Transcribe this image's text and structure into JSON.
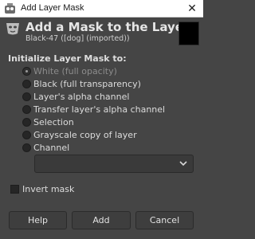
{
  "window": {
    "title": "Add Layer Mask",
    "close_glyph": "✕"
  },
  "header": {
    "title": "Add a Mask to the Layer",
    "subtitle": "Black-47 ([dog] (imported))",
    "icon": "mask-icon"
  },
  "init": {
    "section_label": "Initialize Layer Mask to:",
    "options": [
      {
        "label": "White (full opacity)",
        "selected": true
      },
      {
        "label": "Black (full transparency)",
        "selected": false
      },
      {
        "label": "Layer's alpha channel",
        "selected": false
      },
      {
        "label": "Transfer layer's alpha channel",
        "selected": false
      },
      {
        "label": "Selection",
        "selected": false
      },
      {
        "label": "Grayscale copy of layer",
        "selected": false
      },
      {
        "label": "Channel",
        "selected": false
      }
    ],
    "channel_value": ""
  },
  "invert": {
    "label": "Invert mask",
    "checked": false
  },
  "buttons": {
    "help": "Help",
    "add": "Add",
    "cancel": "Cancel"
  },
  "colors": {
    "background": "#454545",
    "titlebar": "#ffffff",
    "text": "#dcdcdc"
  }
}
